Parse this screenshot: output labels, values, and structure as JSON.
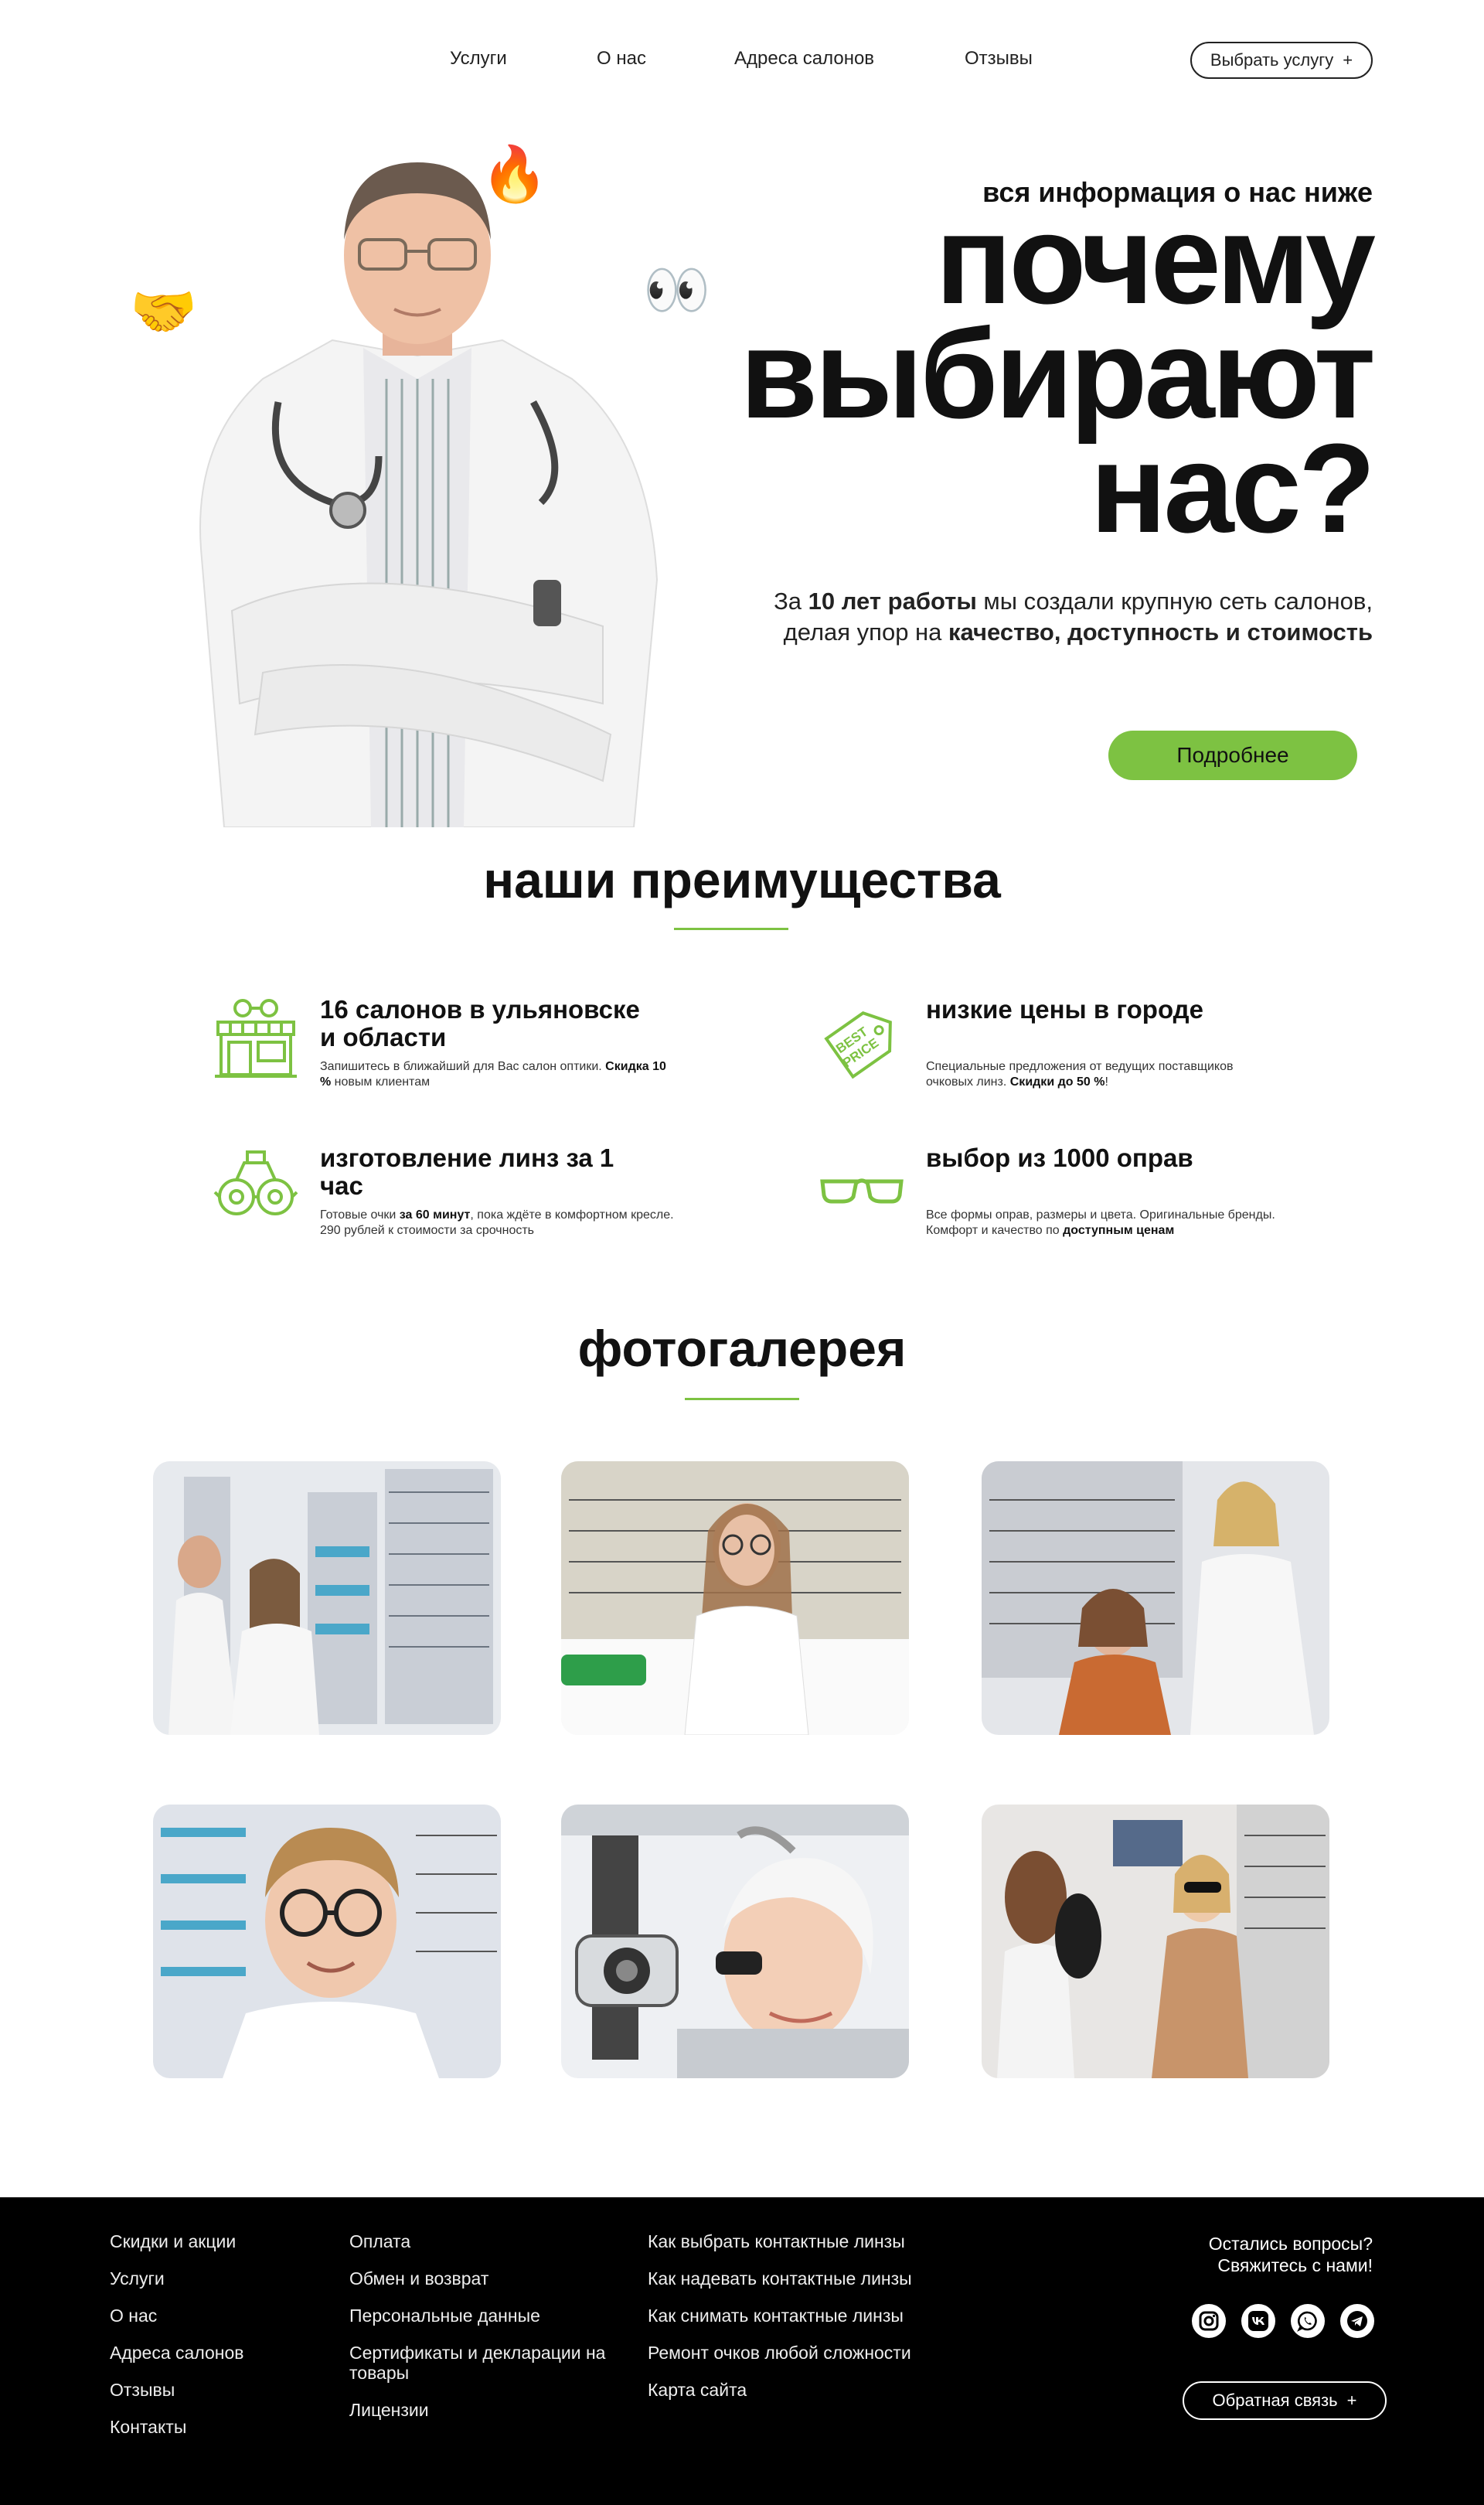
{
  "nav": {
    "links": [
      "Услуги",
      "О нас",
      "Адреса салонов",
      "Отзывы"
    ],
    "cta_label": "Выбрать услугу",
    "cta_plus": "+"
  },
  "hero": {
    "kicker": "вся информация о нас ниже",
    "title_lines": [
      "почему",
      "выбирают",
      "нас?"
    ],
    "text_parts": [
      "За ",
      "10 лет работы",
      " мы создали крупную сеть салонов, делая упор на ",
      "качество, доступность и стоимость"
    ],
    "button_label": "Подробнее",
    "decor_icons": [
      "handshake-emoji",
      "fire-emoji",
      "eyes-emoji"
    ]
  },
  "advantages": {
    "title": "наши преимущества",
    "items": [
      {
        "icon": "store-icon",
        "title": "16 салонов в ульяновске и области",
        "desc_parts": [
          "Запишитесь в ближайший для Вас салон оптики. ",
          "Скидка 10 %",
          " новым клиентам"
        ]
      },
      {
        "icon": "price-tag-icon",
        "title": "низкие цены в городе",
        "desc_parts": [
          "Специальные предложения от ведущих поставщиков очковых линз. ",
          "Скидки до 50 %",
          "!"
        ]
      },
      {
        "icon": "lens-machine-icon",
        "title": "изготовление линз за 1 час",
        "desc_parts": [
          "Готовые очки ",
          "за 60 минут",
          ", пока ждёте в комфортном кресле. 290 рублей к стоимости за срочность"
        ]
      },
      {
        "icon": "glasses-icon",
        "title": "выбор из 1000 оправ",
        "desc_parts": [
          "Все формы оправ, размеры и цвета. Оригинальные бренды. Комфорт и качество по ",
          "доступным ценам",
          ""
        ]
      }
    ],
    "price_tag_text": [
      "BEST",
      "PRICE"
    ]
  },
  "gallery": {
    "title": "фотогалерея",
    "photos": [
      "optician-fitting-photo",
      "girl-trying-glasses-photo",
      "eye-exam-frames-photo",
      "boy-glasses-photo",
      "slit-lamp-exam-photo",
      "woman-sunglasses-photo"
    ]
  },
  "footer": {
    "col1": [
      "Скидки и акции",
      "Услуги",
      "О нас",
      "Адреса салонов",
      "Отзывы",
      "Контакты"
    ],
    "col2": [
      "Оплата",
      "Обмен и возврат",
      "Персональные данные",
      "Сертификаты и декларации на товары",
      "Лицензии"
    ],
    "col3": [
      "Как выбрать контактные линзы",
      "Как надевать контактные линзы",
      "Как снимать контактные линзы",
      "Ремонт очков любой сложности",
      "Карта сайта"
    ],
    "question_line1": "Остались вопросы?",
    "question_line2": "Свяжитесь с нами!",
    "socials": [
      "instagram-icon",
      "vk-icon",
      "whatsapp-icon",
      "telegram-icon"
    ],
    "feedback_label": "Обратная связь",
    "feedback_plus": "+"
  },
  "colors": {
    "accent": "#7dc242",
    "footer_bg": "#000000",
    "text": "#111111"
  }
}
